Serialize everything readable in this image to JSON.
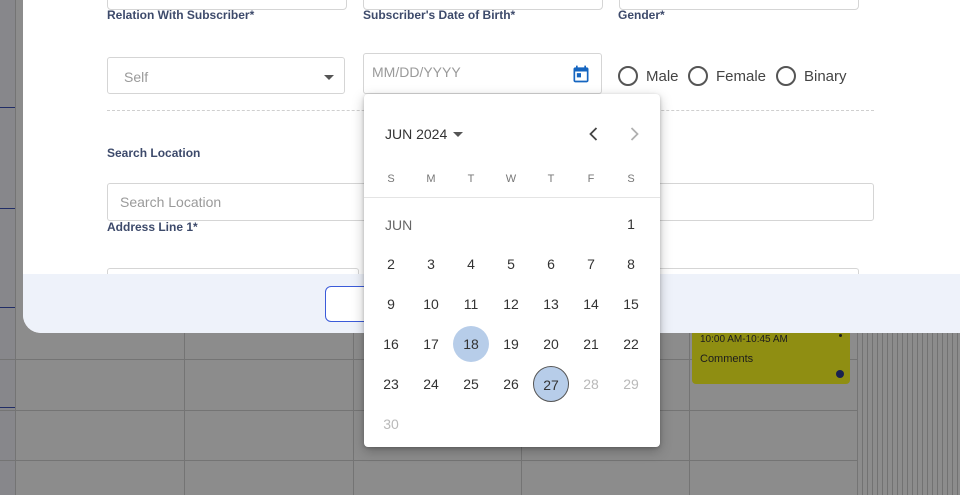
{
  "form": {
    "relation_label": "Relation With Subscriber*",
    "relation_value": "Self",
    "dob_label": "Subscriber's Date of Birth*",
    "dob_placeholder": "MM/DD/YYYY",
    "gender_label": "Gender*",
    "gender_options": [
      "Male",
      "Female",
      "Binary"
    ],
    "search_location_label": "Search Location",
    "search_location_placeholder": "Search Location",
    "address_line1_label": "Address Line 1*"
  },
  "datepicker": {
    "month_label": "JUN 2024",
    "mini_month": "JUN",
    "weekdays": [
      "S",
      "M",
      "T",
      "W",
      "T",
      "F",
      "S"
    ],
    "selected_day": 18,
    "today_day": 27,
    "days": [
      "1",
      "2",
      "3",
      "4",
      "5",
      "6",
      "7",
      "8",
      "9",
      "10",
      "11",
      "12",
      "13",
      "14",
      "15",
      "16",
      "17",
      "18",
      "19",
      "20",
      "21",
      "22",
      "23",
      "24",
      "25",
      "26",
      "27",
      "28",
      "29",
      "30"
    ],
    "disabled_days": [
      28,
      29,
      30
    ]
  },
  "background_event": {
    "time": "10:00 AM-10:45 AM",
    "comments": "Comments",
    "color": "#f7f51f"
  },
  "colors": {
    "accent": "#3b5bd9",
    "calendar_icon": "#1565c0",
    "selected_day": "#b7cde9"
  }
}
